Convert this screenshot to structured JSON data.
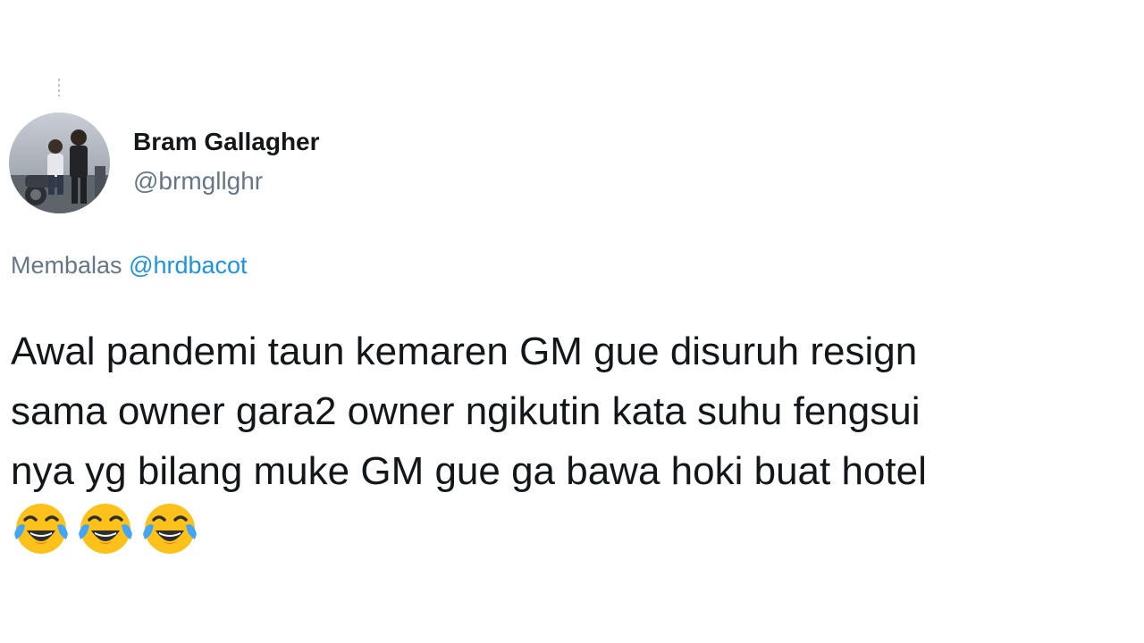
{
  "tweet": {
    "author": {
      "display_name": "Bram Gallagher",
      "handle": "@brmgllghr"
    },
    "reply": {
      "prefix": "Membalas",
      "mention": "@hrdbacot"
    },
    "text_lines": [
      "Awal pandemi taun kemaren GM gue disuruh resign",
      "sama owner gara2 owner ngikutin kata suhu fengsui",
      "nya yg bilang muke GM gue ga bawa hoki buat hotel"
    ],
    "emojis": [
      "face-with-tears-of-joy-icon",
      "face-with-tears-of-joy-icon",
      "face-with-tears-of-joy-icon"
    ]
  },
  "colors": {
    "text": "#14171a",
    "secondary": "#657786",
    "link": "#1b95e0",
    "emoji_face": "#fcc21b"
  }
}
